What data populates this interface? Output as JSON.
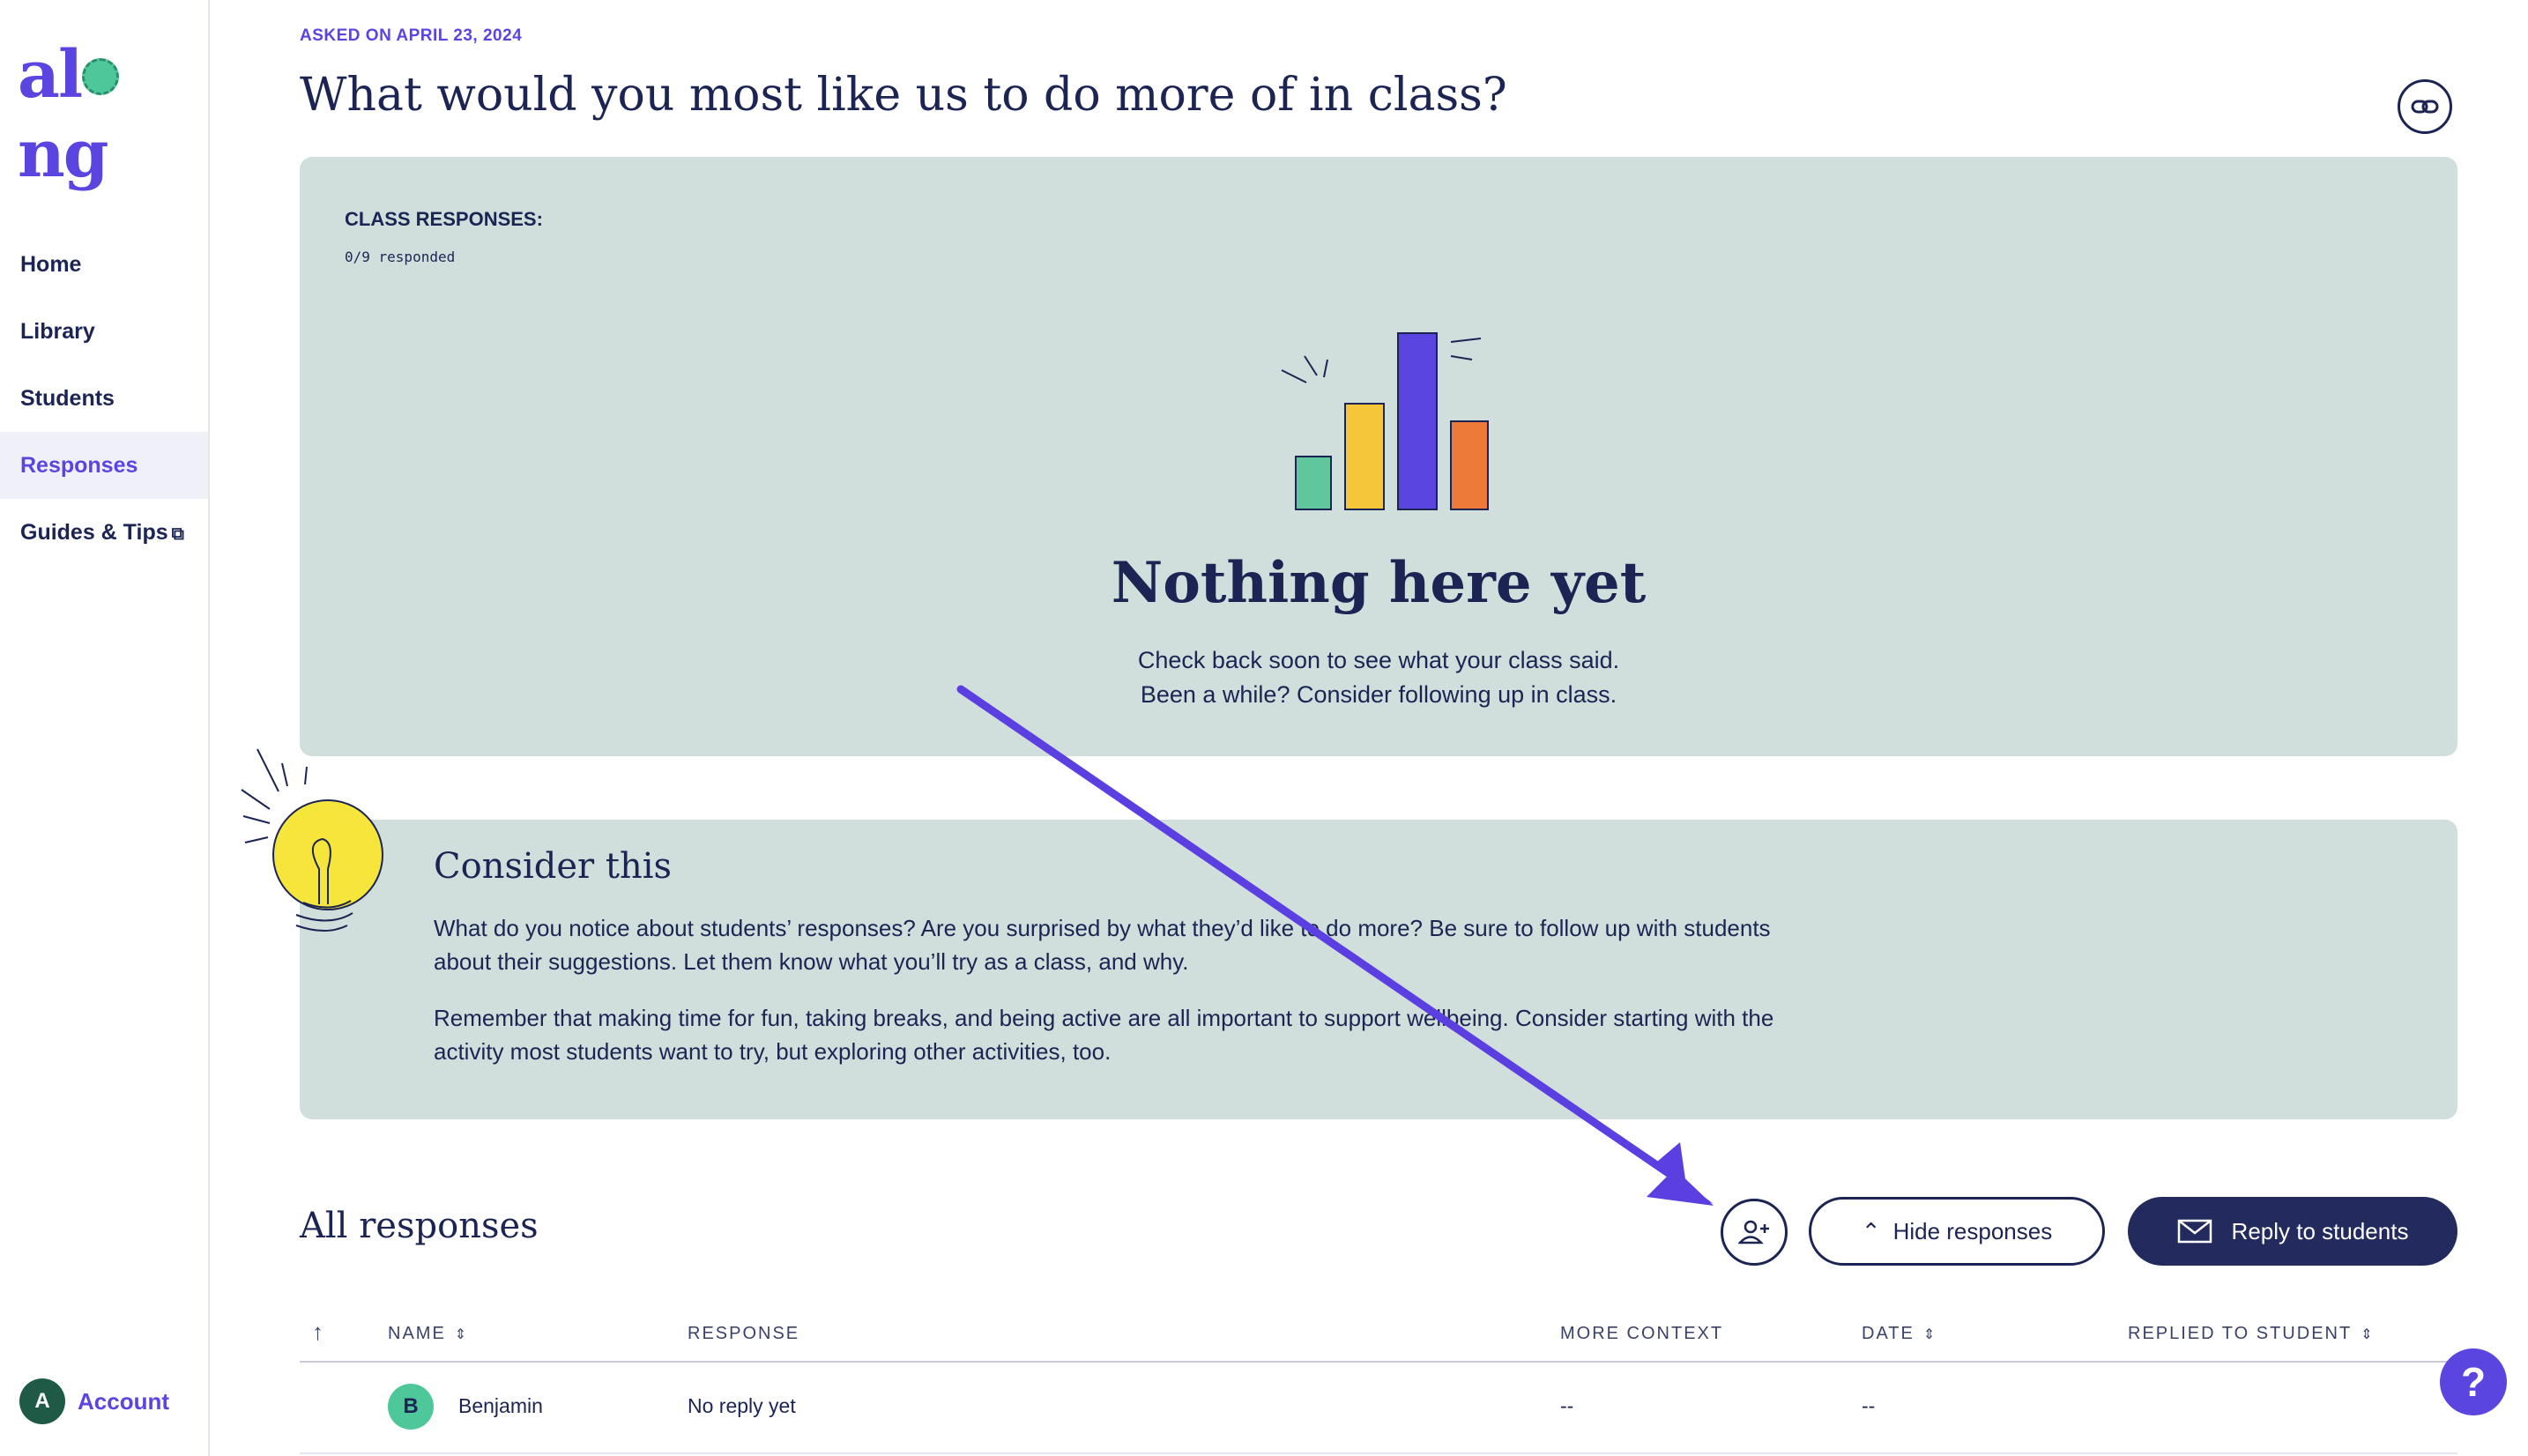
{
  "brand": {
    "logo_text_left": "al",
    "logo_text_right": "ng"
  },
  "sidebar": {
    "items": [
      {
        "label": "Home"
      },
      {
        "label": "Library"
      },
      {
        "label": "Students"
      },
      {
        "label": "Responses"
      },
      {
        "label": "Guides & Tips"
      }
    ],
    "active": "Responses",
    "account": {
      "avatar_letter": "A",
      "label": "Account"
    }
  },
  "header": {
    "asked": "ASKED ON APRIL 23, 2024",
    "title": "What would you most like us to do more of in class?"
  },
  "class_panel": {
    "label": "CLASS RESPONSES:",
    "responded": "0/9 responded",
    "empty_title": "Nothing here yet",
    "empty_line1": "Check back soon to see what your class said.",
    "empty_line2": "Been a while? Consider following up in class."
  },
  "consider": {
    "title": "Consider this",
    "p1_line1": "What do you notice about students’ responses? Are you surprised by what they’d like to do more? Be sure to follow up with students",
    "p1_line2": "about their suggestions. Let them know what you’ll try as a class, and why.",
    "p2_line1": "Remember that making time for fun, taking breaks, and being active are all important to support wellbeing. Consider starting with the",
    "p2_line2": "activity most students want to try, but exploring other activities, too."
  },
  "responses": {
    "title": "All responses",
    "hide_label": "Hide responses",
    "reply_label": "Reply to students",
    "columns": [
      "NAME",
      "RESPONSE",
      "MORE CONTEXT",
      "DATE",
      "REPLIED TO STUDENT"
    ],
    "rows": [
      {
        "initial": "B",
        "name": "Benjamin",
        "response": "No reply yet",
        "context": "--",
        "date": "--",
        "replied": ""
      }
    ]
  },
  "help": {
    "label": "?"
  },
  "colors": {
    "accent": "#5b45e0",
    "navy": "#1c2453",
    "panel": "#d0dfdc",
    "green": "#4ec79a"
  }
}
